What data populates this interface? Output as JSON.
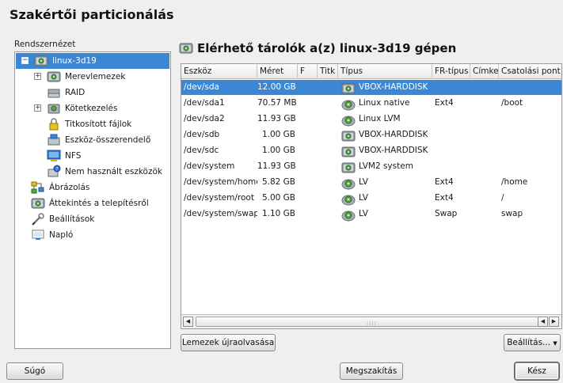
{
  "window": {
    "title": "Szakértői particionálás"
  },
  "left": {
    "label": "Rendszernézet",
    "tree": [
      {
        "label": "linux-3d19",
        "icon": "harddisk-icon",
        "expander": "⊟",
        "selected": true
      },
      {
        "label": "Merevlemezek",
        "icon": "harddisk-icon",
        "expander": "⊞"
      },
      {
        "label": "RAID",
        "icon": "raid-icon"
      },
      {
        "label": "Kötetkezelés",
        "icon": "volume-icon",
        "expander": "⊞"
      },
      {
        "label": "Titkosított fájlok",
        "icon": "lock-icon"
      },
      {
        "label": "Eszköz-összerendelő",
        "icon": "mapper-icon"
      },
      {
        "label": "NFS",
        "icon": "nfs-icon"
      },
      {
        "label": "Nem használt eszközök",
        "icon": "unused-icon"
      },
      {
        "label": "Ábrázolás",
        "icon": "graph-icon"
      },
      {
        "label": "Áttekintés a telepítésről",
        "icon": "harddisk-icon"
      },
      {
        "label": "Beállítások",
        "icon": "settings-icon"
      },
      {
        "label": "Napló",
        "icon": "log-icon"
      }
    ]
  },
  "panel": {
    "title": "Elérhető tárolók a(z) linux-3d19 gépen",
    "columns": [
      "Eszköz",
      "Méret",
      "F",
      "Titk",
      "Típus",
      "FR-típus",
      "Címke",
      "Csatolási pont"
    ],
    "rows": [
      {
        "device": "/dev/sda",
        "size": "12.00 GB",
        "f": "",
        "enc": "",
        "type": "VBOX-HARDDISK",
        "type_icon": "harddisk-icon",
        "fs": "",
        "label": "",
        "mount": "",
        "selected": true
      },
      {
        "device": "/dev/sda1",
        "size": "70.57 MB",
        "f": "",
        "enc": "",
        "type": "Linux native",
        "type_icon": "partition-icon",
        "fs": "Ext4",
        "label": "",
        "mount": "/boot"
      },
      {
        "device": "/dev/sda2",
        "size": "11.93 GB",
        "f": "",
        "enc": "",
        "type": "Linux LVM",
        "type_icon": "partition-icon",
        "fs": "",
        "label": "",
        "mount": ""
      },
      {
        "device": "/dev/sdb",
        "size": "1.00 GB",
        "f": "",
        "enc": "",
        "type": "VBOX-HARDDISK",
        "type_icon": "harddisk-icon",
        "fs": "",
        "label": "",
        "mount": ""
      },
      {
        "device": "/dev/sdc",
        "size": "1.00 GB",
        "f": "",
        "enc": "",
        "type": "VBOX-HARDDISK",
        "type_icon": "harddisk-icon",
        "fs": "",
        "label": "",
        "mount": ""
      },
      {
        "device": "/dev/system",
        "size": "11.93 GB",
        "f": "",
        "enc": "",
        "type": "LVM2 system",
        "type_icon": "harddisk-icon",
        "fs": "",
        "label": "",
        "mount": ""
      },
      {
        "device": "/dev/system/home",
        "size": "5.82 GB",
        "f": "",
        "enc": "",
        "type": "LV",
        "type_icon": "partition-icon",
        "fs": "Ext4",
        "label": "",
        "mount": "/home"
      },
      {
        "device": "/dev/system/root",
        "size": "5.00 GB",
        "f": "",
        "enc": "",
        "type": "LV",
        "type_icon": "partition-icon",
        "fs": "Ext4",
        "label": "",
        "mount": "/"
      },
      {
        "device": "/dev/system/swap",
        "size": "1.10 GB",
        "f": "",
        "enc": "",
        "type": "LV",
        "type_icon": "partition-icon",
        "fs": "Swap",
        "label": "",
        "mount": "swap"
      }
    ],
    "rescan_button": "Lemezek újraolvasása",
    "settings_button": "Beállítás..."
  },
  "footer": {
    "help_button": "Súgó",
    "cancel_button": "Megszakítás",
    "finish_button": "Kész"
  },
  "colors": {
    "selection": "#3b87d4"
  }
}
